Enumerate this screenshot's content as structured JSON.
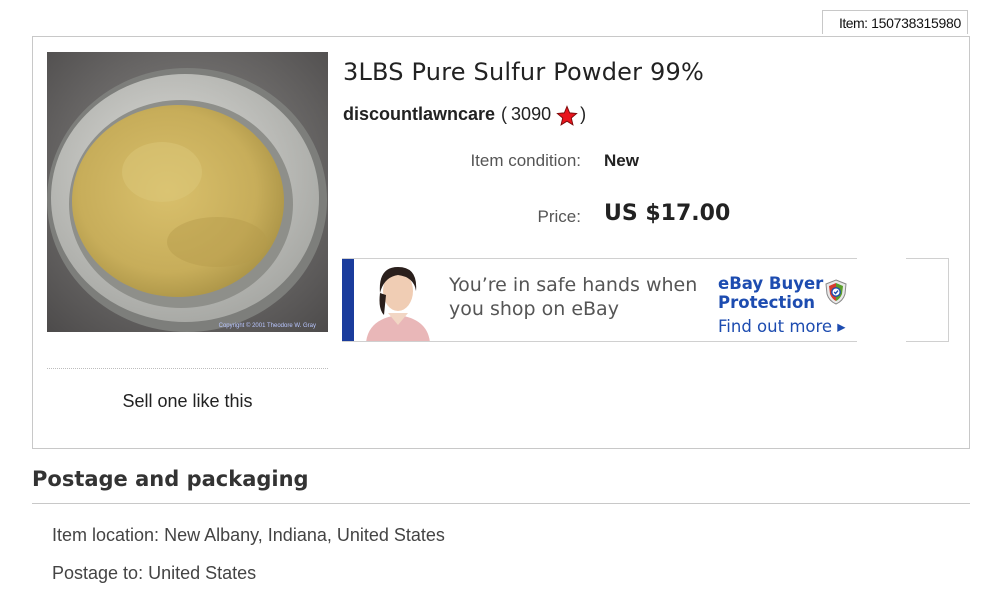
{
  "item": {
    "number_label": "Item:",
    "number": "150738315980",
    "title": "3LBS Pure Sulfur Powder 99%",
    "image_alt": "Yellow sulfur powder in a metal bowl",
    "photo_credit": "Copyright © 2001 Theodore W. Gray"
  },
  "seller": {
    "name": "discountlawncare",
    "open_paren": "(",
    "feedback_score": "3090",
    "close_paren": ")",
    "star_color": "#e8141c"
  },
  "details": {
    "condition_label": "Item condition:",
    "condition_value": "New",
    "price_label": "Price:",
    "price_value": "US $17.00"
  },
  "banner": {
    "text": "You’re in safe hands when you shop on eBay",
    "protection_title": "eBay Buyer Protection",
    "find_more": "Find out more ▸",
    "accent_color": "#1a3c9c",
    "link_color": "#1d4cb0"
  },
  "sell_one_label": "Sell one like this",
  "postage": {
    "heading": "Postage and packaging",
    "location_label": "Item location:",
    "location_value": "New Albany, Indiana, United States",
    "postage_to_label": "Postage to:",
    "postage_to_value": "United States"
  }
}
